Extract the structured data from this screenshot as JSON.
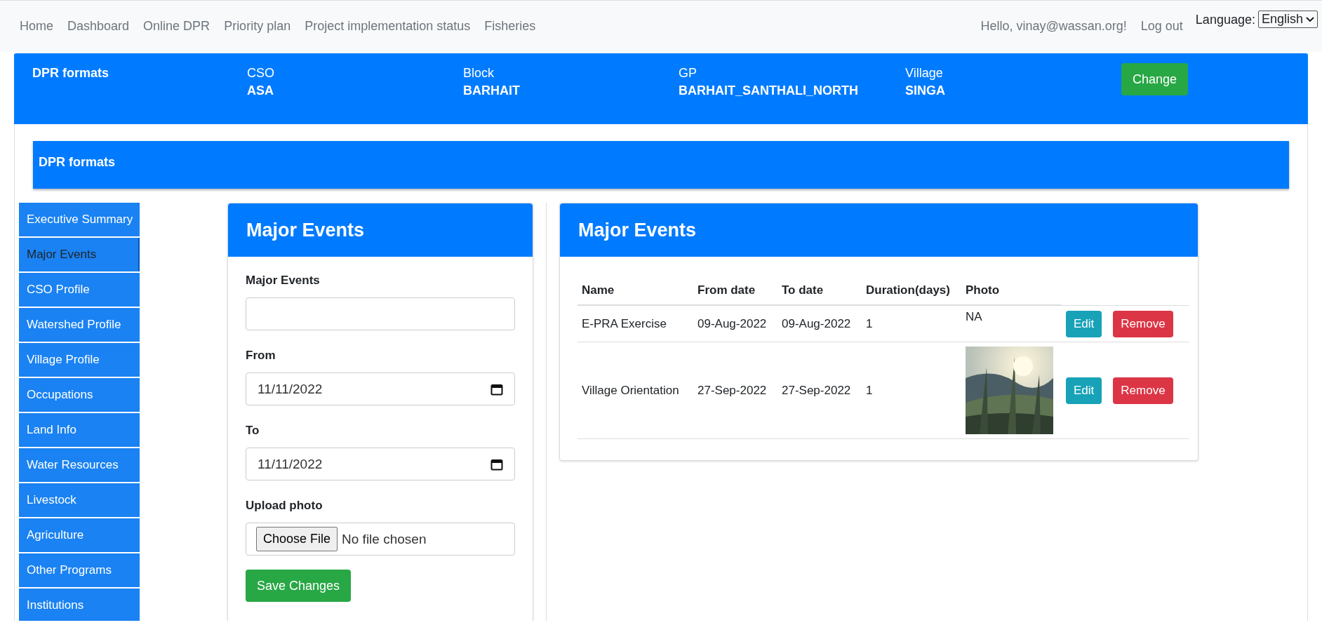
{
  "navbar": {
    "links": [
      {
        "label": "Home"
      },
      {
        "label": "Dashboard"
      },
      {
        "label": "Online DPR"
      },
      {
        "label": "Priority plan"
      },
      {
        "label": "Project implementation status"
      },
      {
        "label": "Fisheries"
      }
    ],
    "greeting": "Hello, vinay@wassan.org!",
    "logout": "Log out",
    "language_label": "Language:",
    "language_value": "English"
  },
  "context_bar": {
    "title": "DPR formats",
    "fields": [
      {
        "label": "CSO",
        "value": "ASA"
      },
      {
        "label": "Block",
        "value": "BARHAIT"
      },
      {
        "label": "GP",
        "value": "BARHAIT_SANTHALI_NORTH"
      },
      {
        "label": "Village",
        "value": "SINGA"
      }
    ],
    "button": "Change"
  },
  "section_bar": {
    "title": "DPR formats"
  },
  "sidebar": {
    "items": [
      {
        "label": "Executive Summary",
        "selected": false
      },
      {
        "label": "Major Events",
        "selected": true
      },
      {
        "label": "CSO Profile",
        "selected": false
      },
      {
        "label": "Watershed Profile",
        "selected": false
      },
      {
        "label": "Village Profile",
        "selected": false
      },
      {
        "label": "Occupations",
        "selected": false
      },
      {
        "label": "Land Info",
        "selected": false
      },
      {
        "label": "Water Resources",
        "selected": false
      },
      {
        "label": "Livestock",
        "selected": false
      },
      {
        "label": "Agriculture",
        "selected": false
      },
      {
        "label": "Other Programs",
        "selected": false
      },
      {
        "label": "Institutions",
        "selected": false
      }
    ]
  },
  "form": {
    "title": "Major Events",
    "fields": [
      {
        "kind": "text",
        "label": "Major Events"
      },
      {
        "kind": "date",
        "label": "From",
        "value": "11/11/2022"
      },
      {
        "kind": "date",
        "label": "To",
        "value": "11/11/2022"
      },
      {
        "kind": "file",
        "label": "Upload photo",
        "button": "Choose File",
        "value": "No file chosen"
      }
    ],
    "submit": "Save Changes"
  },
  "table_card": {
    "title": "Major Events",
    "columns": [
      "Name",
      "From date",
      "To date",
      "Duration(days)",
      "Photo"
    ],
    "rows": [
      {
        "name": "E-PRA Exercise",
        "from": "09-Aug-2022",
        "to": "09-Aug-2022",
        "duration": "1",
        "photo": {
          "kind": "text",
          "text": "NA"
        },
        "actions": [
          "Edit",
          "Remove"
        ]
      },
      {
        "name": "Village Orientation",
        "from": "27-Sep-2022",
        "to": "27-Sep-2022",
        "duration": "1",
        "actions": [
          "Edit",
          "Remove"
        ]
      }
    ]
  }
}
